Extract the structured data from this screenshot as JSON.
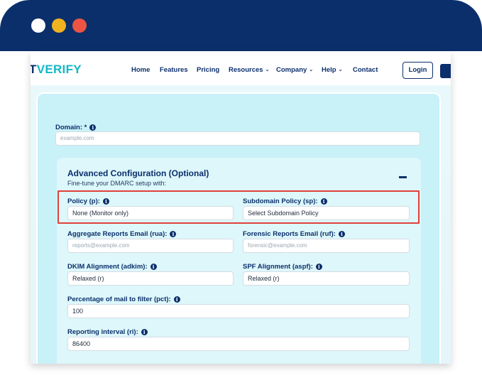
{
  "window": {
    "controls": [
      "close",
      "minimize",
      "maximize"
    ]
  },
  "nav": {
    "logo_visible": "T",
    "logo_accent": "VERIFY",
    "links": [
      {
        "label": "Home",
        "has_caret": false
      },
      {
        "label": "Features",
        "has_caret": false
      },
      {
        "label": "Pricing",
        "has_caret": false
      },
      {
        "label": "Resources",
        "has_caret": true
      },
      {
        "label": "Company",
        "has_caret": true
      },
      {
        "label": "Help",
        "has_caret": true
      },
      {
        "label": "Contact",
        "has_caret": false
      }
    ],
    "login_label": "Login"
  },
  "form": {
    "domain": {
      "label": "Domain: *",
      "placeholder": "example.com"
    },
    "advanced": {
      "title": "Advanced Configuration (Optional)",
      "subtitle": "Fine-tune your DMARC setup with:",
      "policy": {
        "label": "Policy (p):",
        "value": "None (Monitor only)"
      },
      "subdomain_policy": {
        "label": "Subdomain Policy (sp):",
        "value": "Select Subdomain Policy"
      },
      "rua": {
        "label": "Aggregate Reports Email (rua):",
        "placeholder": "reports@example.com"
      },
      "ruf": {
        "label": "Forensic Reports Email (ruf):",
        "placeholder": "forensic@example.com"
      },
      "adkim": {
        "label": "DKIM Alignment (adkim):",
        "value": "Relaxed (r)"
      },
      "aspf": {
        "label": "SPF Alignment (aspf):",
        "value": "Relaxed (r)"
      },
      "pct": {
        "label": "Percentage of mail to filter (pct):",
        "value": "100"
      },
      "ri": {
        "label": "Reporting interval (ri):",
        "value": "86400"
      }
    }
  },
  "colors": {
    "brand_navy": "#0b2f6b",
    "brand_teal": "#13b8c6",
    "highlight_red": "#e0403a"
  }
}
